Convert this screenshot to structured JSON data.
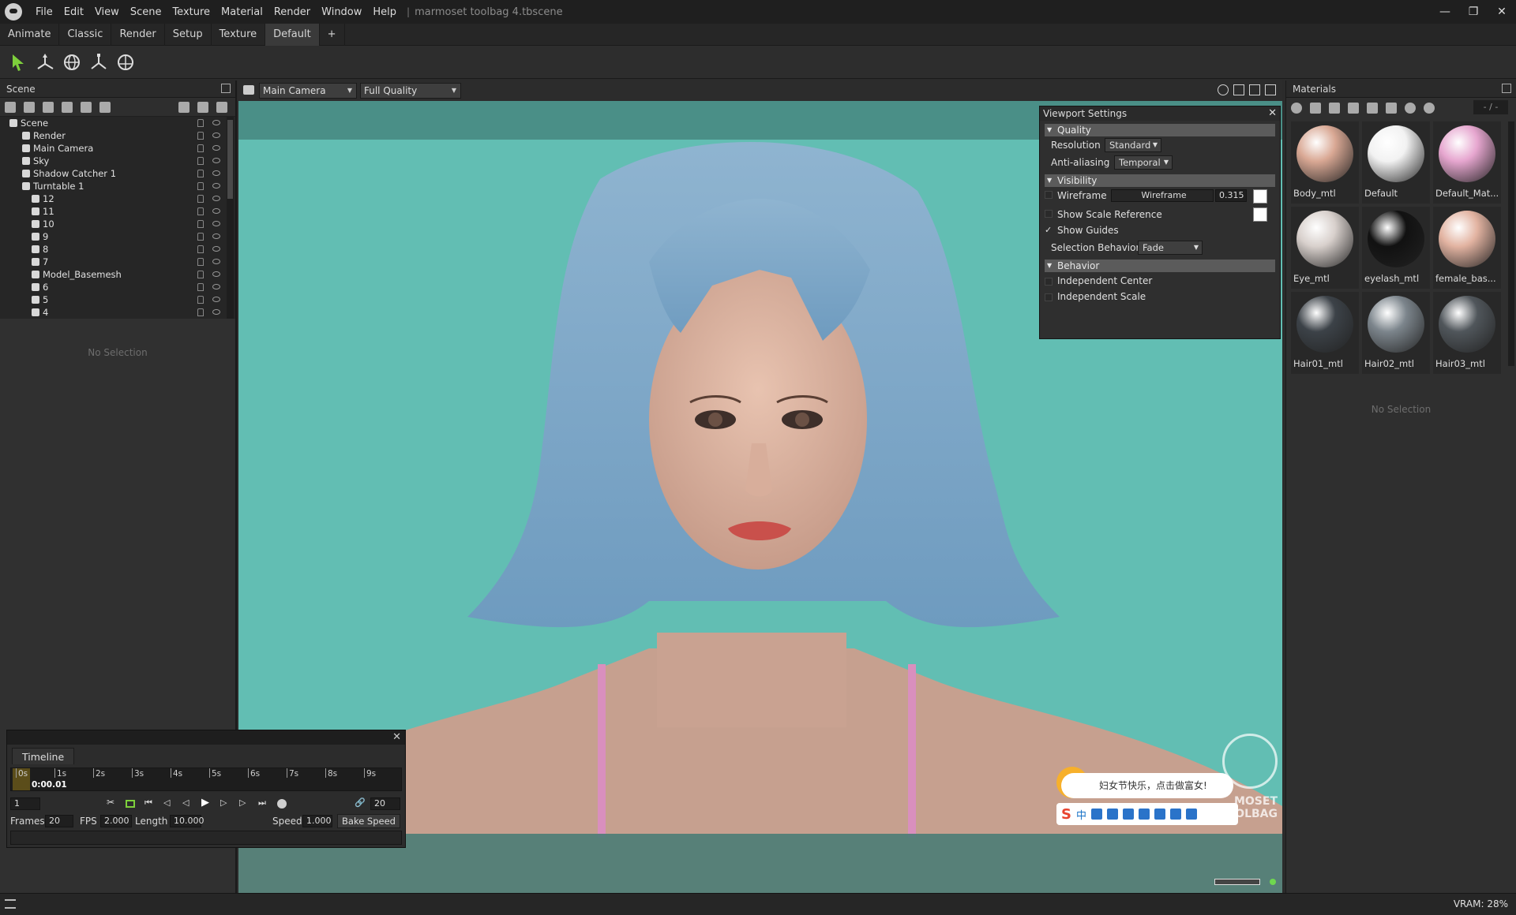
{
  "menu": {
    "items": [
      "File",
      "Edit",
      "View",
      "Scene",
      "Texture",
      "Material",
      "Render",
      "Window",
      "Help"
    ],
    "document_title": "marmoset toolbag 4.tbscene"
  },
  "layout_tabs": [
    "Animate",
    "Classic",
    "Render",
    "Setup",
    "Texture",
    "Default",
    "+"
  ],
  "active_layout_tab": "Default",
  "scene_panel": {
    "title": "Scene",
    "tree": [
      {
        "label": "Scene",
        "level": 0
      },
      {
        "label": "Render",
        "level": 1
      },
      {
        "label": "Main Camera",
        "level": 1
      },
      {
        "label": "Sky",
        "level": 1
      },
      {
        "label": "Shadow Catcher 1",
        "level": 1
      },
      {
        "label": "Turntable 1",
        "level": 1
      },
      {
        "label": "12",
        "level": 2
      },
      {
        "label": "11",
        "level": 2
      },
      {
        "label": "10",
        "level": 2
      },
      {
        "label": "9",
        "level": 2
      },
      {
        "label": "8",
        "level": 2
      },
      {
        "label": "7",
        "level": 2
      },
      {
        "label": "Model_Basemesh",
        "level": 2
      },
      {
        "label": "6",
        "level": 2
      },
      {
        "label": "5",
        "level": 2
      },
      {
        "label": "4",
        "level": 2
      }
    ],
    "properties_empty": "No Selection"
  },
  "timeline": {
    "tab": "Timeline",
    "ticks": [
      "0s",
      "1s",
      "2s",
      "3s",
      "4s",
      "5s",
      "6s",
      "7s",
      "8s",
      "9s"
    ],
    "current_time": "0:00.01",
    "current_frame": "1",
    "end_frame": "20",
    "frames_label": "Frames",
    "frames_value": "20",
    "fps_label": "FPS",
    "fps_value": "2.000",
    "length_label": "Length",
    "length_value": "10.000",
    "speed_label": "Speed",
    "speed_value": "1.000",
    "bake_speed_label": "Bake Speed"
  },
  "viewport": {
    "camera": "Main Camera",
    "quality": "Full Quality",
    "bg_color": "#62beb3"
  },
  "viewport_settings": {
    "title": "Viewport Settings",
    "quality_header": "Quality",
    "resolution_label": "Resolution",
    "resolution_value": "Standard",
    "antialias_label": "Anti-aliasing",
    "antialias_value": "Temporal",
    "visibility_header": "Visibility",
    "wireframe_label": "Wireframe",
    "wireframe_field": "Wireframe",
    "wireframe_value": "0.315",
    "show_scale_ref": "Show Scale Reference",
    "show_guides": "Show Guides",
    "selection_behavior_label": "Selection Behavior",
    "selection_behavior_value": "Fade",
    "behavior_header": "Behavior",
    "independent_center": "Independent Center",
    "independent_scale": "Independent Scale"
  },
  "materials": {
    "title": "Materials",
    "page": "- / -",
    "items": [
      {
        "name": "Body_mtl",
        "color": "#d9a894"
      },
      {
        "name": "Default",
        "color": "#f2f2f2"
      },
      {
        "name": "Default_Mat...",
        "color": "#e6a6cf"
      },
      {
        "name": "Eye_mtl",
        "color": "#d8d0cc"
      },
      {
        "name": "eyelash_mtl",
        "color": "#111111"
      },
      {
        "name": "female_bas...",
        "color": "#e2b3a1"
      },
      {
        "name": "Hair01_mtl",
        "color": "#3c4248"
      },
      {
        "name": "Hair02_mtl",
        "color": "#7c858c"
      },
      {
        "name": "Hair03_mtl",
        "color": "#50565b"
      }
    ],
    "properties_empty": "No Selection"
  },
  "ime": {
    "bubble_text": "妇女节快乐，点击做富女!",
    "mode": "中",
    "watermark_line1": "MOSET",
    "watermark_line2": "TOOLBAG"
  },
  "status": {
    "vram": "VRAM: 28%"
  }
}
